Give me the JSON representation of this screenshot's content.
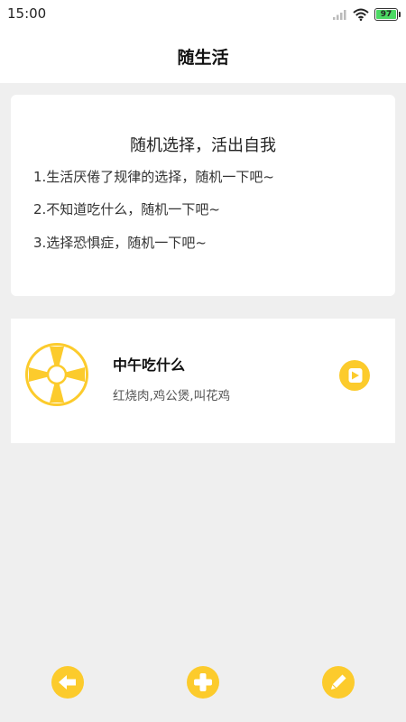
{
  "status_bar": {
    "time": "15:00",
    "battery": "97",
    "icons": [
      "signal-icon",
      "wifi-icon",
      "battery-icon"
    ]
  },
  "header": {
    "title": "随生活"
  },
  "intro": {
    "heading": "随机选择，活出自我",
    "lines": [
      "1.生活厌倦了规律的选择，随机一下吧~",
      "2.不知道吃什么，随机一下吧~",
      "3.选择恐惧症，随机一下吧~"
    ]
  },
  "items": [
    {
      "title": "中午吃什么",
      "options": "红烧肉,鸡公煲,叫花鸡",
      "icon": "wheel-icon",
      "action_icon": "play-icon"
    }
  ],
  "bottom_bar": {
    "icons": [
      "back-arrow-icon",
      "add-icon",
      "edit-pencil-icon"
    ]
  },
  "colors": {
    "accent": "#fccb2c",
    "background": "#efefef",
    "card": "#ffffff"
  }
}
